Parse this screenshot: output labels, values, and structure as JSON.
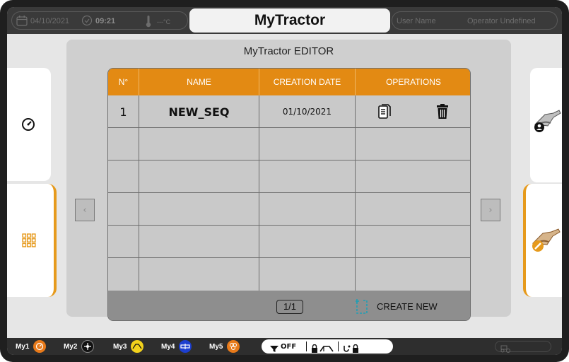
{
  "topbar": {
    "date": "04/10/2021",
    "time": "09:21",
    "temperature": "---°C",
    "app_title": "MyTractor",
    "user_name": "User Name",
    "operator": "Operator Undefined"
  },
  "editor": {
    "title": "MyTractor EDITOR",
    "columns": [
      "N°",
      "NAME",
      "CREATION DATE",
      "OPERATIONS"
    ],
    "rows": [
      {
        "num": "1",
        "name": "NEW_SEQ",
        "date": "01/10/2021"
      },
      {
        "num": "",
        "name": "",
        "date": ""
      },
      {
        "num": "",
        "name": "",
        "date": ""
      },
      {
        "num": "",
        "name": "",
        "date": ""
      },
      {
        "num": "",
        "name": "",
        "date": ""
      },
      {
        "num": "",
        "name": "",
        "date": ""
      }
    ],
    "page_indicator": "1/1",
    "create_new_label": "CREATE NEW",
    "prev_arrow": "‹",
    "next_arrow": "›"
  },
  "bottombar": {
    "my1": "My1",
    "my2": "My2",
    "my3": "My3",
    "my4": "My4",
    "my5": "My5",
    "off_label": "OFF"
  },
  "colors": {
    "accent_orange": "#e38a13",
    "bar_dark": "#3a3a3a",
    "blue": "#1d3fd0",
    "yellow": "#f2d21c"
  }
}
